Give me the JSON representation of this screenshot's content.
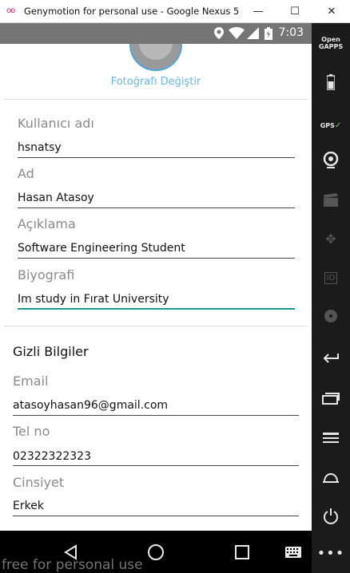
{
  "window": {
    "title": "Genymotion for personal use - Google Nexus 5 - ...",
    "app_icon": "oo",
    "minimize": "—",
    "maximize": "☐",
    "close": "✕"
  },
  "statusbar": {
    "time": "7:03",
    "icons": [
      "location-icon",
      "wifi-icon",
      "signal-icon",
      "battery-icon"
    ]
  },
  "profile": {
    "change_photo": "Fotoğrafı Değiştir",
    "fields": [
      {
        "label": "Kullanıcı adı",
        "value": "hsnatsy"
      },
      {
        "label": "Ad",
        "value": "Hasan Atasoy"
      },
      {
        "label": "Açıklama",
        "value": "Software Engineering Student"
      },
      {
        "label": "Biyografi",
        "value": "Im study in Fırat University"
      }
    ]
  },
  "private": {
    "title": "Gizli Bilgiler",
    "fields": [
      {
        "label": "Email",
        "value": "atasoyhasan96@gmail.com"
      },
      {
        "label": "Tel no",
        "value": "02322322323"
      },
      {
        "label": "Cinsiyet",
        "value": "Erkek"
      }
    ]
  },
  "sidepanel": {
    "open_gapps": "Open\nGAPPS",
    "gps": "GPS",
    "id": "ID"
  },
  "watermark": "free for personal use",
  "colors": {
    "accent": "#1d9a8a",
    "link": "#69b7e8",
    "statusbar": "#757575",
    "sidepanel": "#1b1b1b"
  }
}
